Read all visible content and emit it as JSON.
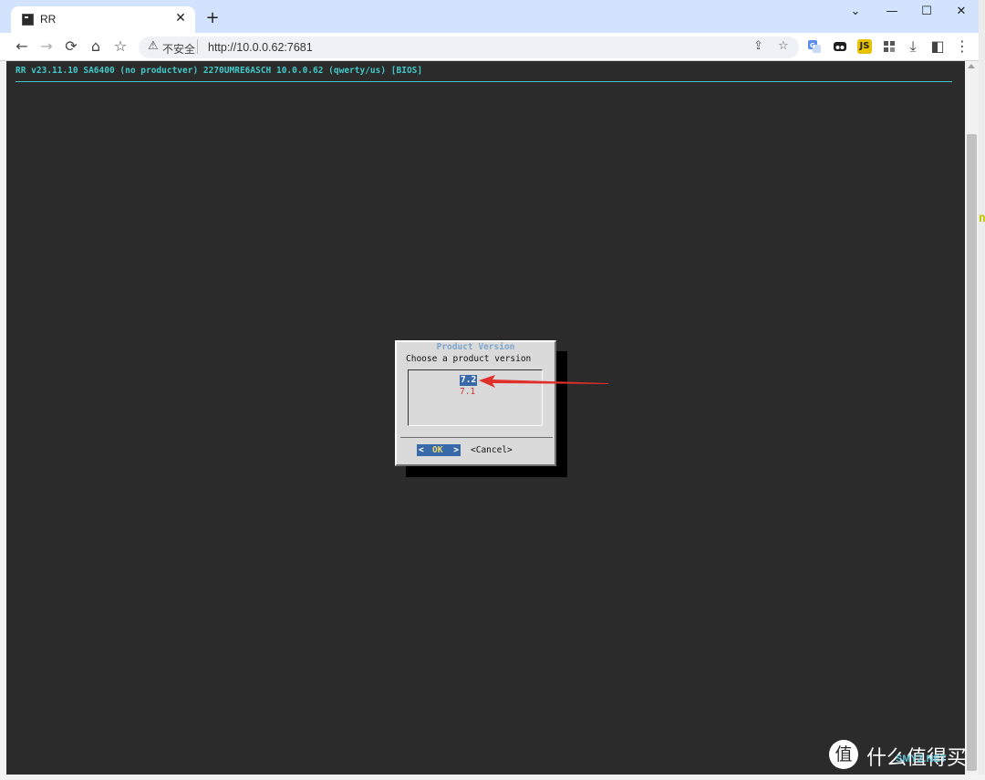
{
  "browser": {
    "tab_title": "RR",
    "tab_close": "✕",
    "new_tab": "+",
    "window_controls": {
      "minimize": "—",
      "maximize": "☐",
      "close": "✕"
    },
    "nav": {
      "back": "←",
      "forward": "→",
      "reload": "⟳",
      "home": "⌂",
      "bookmark": "☆"
    },
    "security_label": "不安全",
    "security_icon": "warning-icon",
    "url": "http://10.0.0.62:7681",
    "extensions": [
      {
        "name": "translate-extension-icon",
        "glyph": "G",
        "color": "#5b8def"
      },
      {
        "name": "incognito-extension-icon",
        "glyph": "●",
        "color": "#1f1f1f"
      },
      {
        "name": "js-extension-icon",
        "glyph": "JS",
        "color": "#e6b800"
      },
      {
        "name": "grid-extension-icon",
        "glyph": "▦",
        "color": "#555555"
      }
    ]
  },
  "terminal": {
    "status_line": "RR v23.11.10 SA6400 (no productver) 2270UMRE6ASCH 10.0.0.62 (qwerty/us) [BIOS]",
    "edge_glyph": "n",
    "accent_color": "#43c8c8",
    "background_color": "#2b2b2b"
  },
  "dialog": {
    "title": "Product Version",
    "prompt": "Choose a product version",
    "items": [
      {
        "label": "7.2",
        "selected": true
      },
      {
        "label": "7.1",
        "selected": false
      }
    ],
    "ok_button": {
      "left": "<",
      "label": "OK",
      "right": ">"
    },
    "cancel_button": "<Cancel>",
    "highlight_color": "#3869a8"
  },
  "annotation": {
    "type": "red-arrow",
    "color": "#e0302a",
    "points_to": "7.2"
  },
  "watermark": {
    "icon_glyph": "值",
    "text": "什么值得买",
    "site": "SMYZ.NET"
  }
}
